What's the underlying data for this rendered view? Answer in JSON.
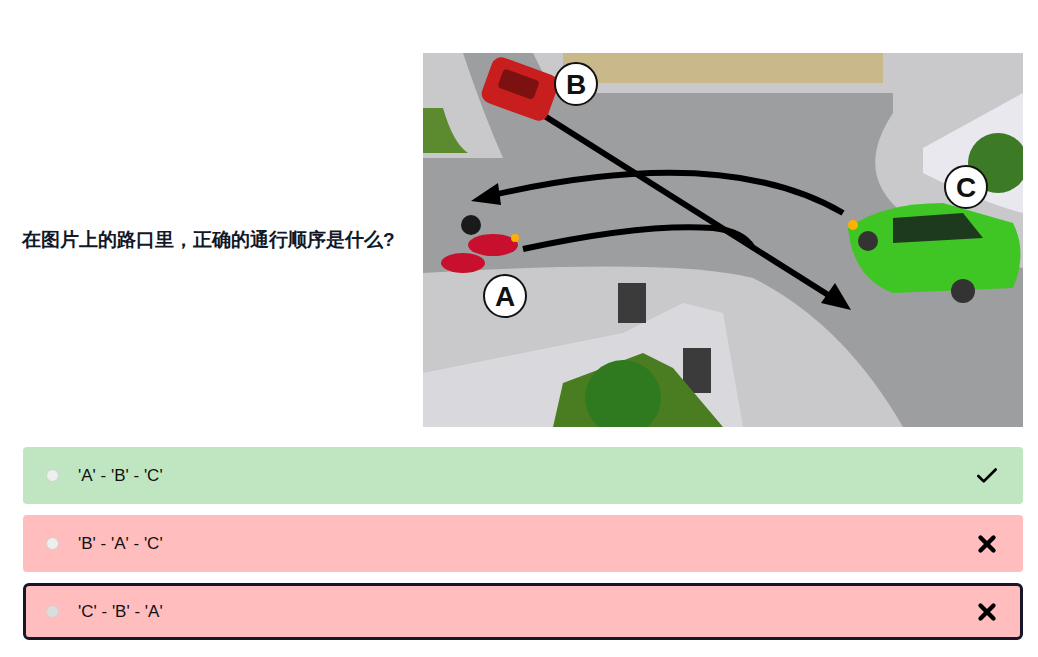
{
  "question": "在图片上的路口里，正确的通行顺序是什么?",
  "image": {
    "markers": [
      {
        "label": "A"
      },
      {
        "label": "B"
      },
      {
        "label": "C"
      }
    ]
  },
  "options": [
    {
      "text": "'A' - 'B' - 'C'",
      "correct": true,
      "selected": false
    },
    {
      "text": "'B' - 'A' - 'C'",
      "correct": false,
      "selected": false
    },
    {
      "text": "'C' - 'B' - 'A'",
      "correct": false,
      "selected": true
    }
  ]
}
